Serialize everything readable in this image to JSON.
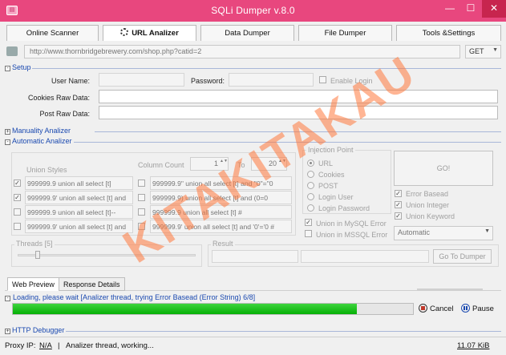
{
  "window": {
    "title": "SQLi Dumper v.8.0",
    "min_glyph": "—",
    "max_glyph": "☐",
    "close_glyph": "✕"
  },
  "tabs": [
    {
      "label": "Online Scanner"
    },
    {
      "label": "URL Analizer"
    },
    {
      "label": "Data Dumper"
    },
    {
      "label": "File Dumper"
    },
    {
      "label": "Tools &Settings"
    }
  ],
  "url": {
    "value": "http://www.thornbridgebrewery.com/shop.php?catid=2",
    "method": "GET",
    "chevron": "▼"
  },
  "setup": {
    "header": "Setup",
    "toggle": "-",
    "username_label": "User Name:",
    "password_label": "Password:",
    "enable_login": "Enable Login",
    "cookies_label": "Cookies Raw Data:",
    "post_label": "Post Raw Data:"
  },
  "manuality": {
    "header": "Manuality Analizer",
    "toggle": "+"
  },
  "automatic": {
    "header": "Automatic Analizer",
    "toggle": "-",
    "union_styles_label": "Union Styles",
    "column_count_label": "Column Count",
    "col_from": "1",
    "to_label": "To",
    "col_to": "20",
    "spin_glyph": "▲▼",
    "check_glyph": "✓",
    "union_styles": [
      {
        "text": "999999.9 union all select [t]",
        "checked": true
      },
      {
        "text": "999999.9' union all select [t] and",
        "checked": true
      },
      {
        "text": "999999.9 union all select [t]--",
        "checked": false
      },
      {
        "text": "999999.9' union all select [t] and",
        "checked": false
      },
      {
        "text": "999999.9\" union all select [t] and \"0\"=\"0",
        "checked": false
      },
      {
        "text": "999999.9) union all select [t] and (0=0",
        "checked": false
      },
      {
        "text": "999999.9 union all select [t] #",
        "checked": false
      },
      {
        "text": "999999.9' union all select [t] and '0'='0 #",
        "checked": false
      }
    ],
    "injection_point_label": "Injection Point",
    "injection_points": [
      {
        "text": "URL",
        "checked": true
      },
      {
        "text": "Cookies",
        "checked": false
      },
      {
        "text": "POST",
        "checked": false
      },
      {
        "text": "Login User",
        "checked": false
      },
      {
        "text": "Login Password",
        "checked": false
      }
    ],
    "go_label": "GO!",
    "error_types": [
      {
        "text": "Error Basead",
        "checked": true
      },
      {
        "text": "Union Integer",
        "checked": true
      },
      {
        "text": "Union Keyword",
        "checked": true
      }
    ],
    "union_mysql_error": {
      "text": "Union in MySQL Error",
      "checked": true
    },
    "union_mssql_error": {
      "text": "Union in MSSQL Error",
      "checked": false
    },
    "mode": "Automatic",
    "threads_label": "Threads [5]",
    "threads_level": 0.1,
    "result_label": "Result",
    "go_dumper_label": "Go To Dumper"
  },
  "subtabs": [
    {
      "label": "Web Preview"
    },
    {
      "label": "Response Details"
    }
  ],
  "progress": {
    "toggle": "-",
    "text": "Loading, please wait [Analizer thread, trying Error Basead (Error String) 6/8]",
    "percent": 86,
    "cancel_label": "Cancel",
    "pause_label": "Pause"
  },
  "http_debugger": {
    "header": "HTTP Debugger",
    "toggle": "+"
  },
  "status": {
    "proxy_label": "Proxy IP:",
    "proxy_value": "N/A",
    "separator": "|",
    "message": "Analizer thread, working...",
    "size": "11.07 KiB"
  },
  "watermark": "KITAKITAKAU",
  "colors": {
    "titlebar": "#e8477e",
    "progress": "#06b006",
    "link": "#1a49b0",
    "watermark": "#ff783c"
  }
}
